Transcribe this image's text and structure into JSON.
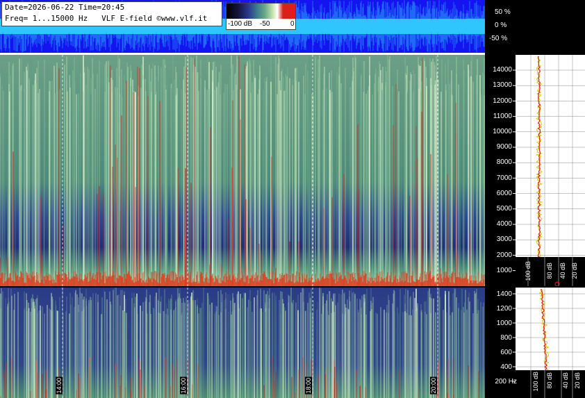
{
  "header": {
    "line1": "Date=2026-06-22 Time=20:45",
    "line2": "Freq= 1...15000 Hz   VLF E-field ©www.vlf.it"
  },
  "colorbar": {
    "tick_minus100": "-100 dB",
    "tick_minus50": "-50",
    "tick_0": "0"
  },
  "waveform_scale": {
    "top": "50 %",
    "mid": "0 %",
    "bottom": "-50 %"
  },
  "upper_freq_axis": [
    "14000",
    "13000",
    "12000",
    "11000",
    "10000",
    "9000",
    "8000",
    "7000",
    "6000",
    "5000",
    "4000",
    "3000",
    "2000",
    "1000"
  ],
  "lower_freq_axis": [
    "1400",
    "1200",
    "1000",
    "800",
    "600",
    "400",
    "200 Hz"
  ],
  "db_scale_upper": [
    "100 dB",
    "80 dB",
    "40 dB",
    "20 dB"
  ],
  "db_scale_lower": [
    "100 dB",
    "80 dB",
    "40 dB",
    "20 dB"
  ],
  "time_labels": [
    "14:00",
    "16:00",
    "18:00",
    "20:00"
  ],
  "colors": {
    "wave_bg": "#1414f0",
    "wave_trace": "#33e6ff",
    "spectrum_green": "#5a8e76",
    "spectrum_blue": "#2b3c86",
    "spike_red": "#e02418",
    "avg_yellow": "#e8f070"
  }
}
